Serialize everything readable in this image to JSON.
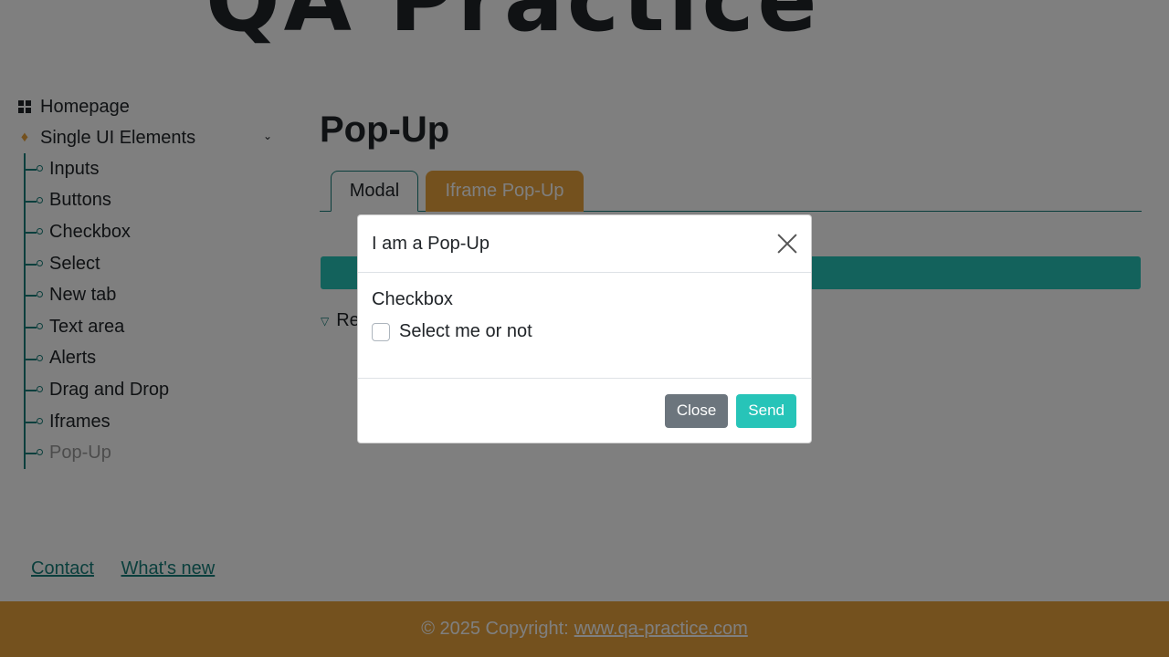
{
  "header": {
    "logo_text": "QA Practice"
  },
  "sidebar": {
    "homepage_label": "Homepage",
    "section_label": "Single UI Elements",
    "items": [
      {
        "label": "Inputs"
      },
      {
        "label": "Buttons"
      },
      {
        "label": "Checkbox"
      },
      {
        "label": "Select"
      },
      {
        "label": "New tab"
      },
      {
        "label": "Text area"
      },
      {
        "label": "Alerts"
      },
      {
        "label": "Drag and Drop"
      },
      {
        "label": "Iframes"
      },
      {
        "label": "Pop-Up"
      }
    ],
    "active_item": "Pop-Up"
  },
  "main": {
    "title": "Pop-Up",
    "tabs": [
      {
        "label": "Modal"
      },
      {
        "label": "Iframe Pop-Up"
      }
    ],
    "details_label": "Re"
  },
  "modal": {
    "title": "I am a Pop-Up",
    "section_heading": "Checkbox",
    "checkbox_label": "Select me or not",
    "close_label": "Close",
    "send_label": "Send"
  },
  "links": {
    "contact": "Contact",
    "whats_new": "What's new"
  },
  "footer": {
    "copyright": "© 2025 Copyright:",
    "site_link": "www.qa-practice.com"
  },
  "colors": {
    "accent_teal": "#27c4b8",
    "dark_teal": "#177f7a",
    "orange": "#e8a33d",
    "close_button": "#6c757d"
  }
}
